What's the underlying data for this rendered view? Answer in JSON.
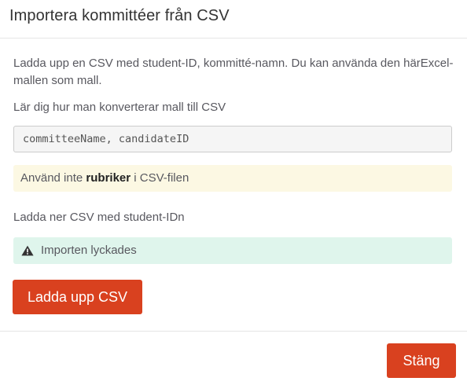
{
  "dialog": {
    "title": "Importera kommittéer från CSV"
  },
  "body": {
    "description": "Ladda upp en CSV med student-ID, kommitté-namn. Du kan använda den härExcel-mallen som mall.",
    "convert_link": "Lär dig hur man konverterar mall till CSV",
    "format_example": "committeeName, candidateID",
    "warning": {
      "before": "Använd inte ",
      "bold": "rubriker",
      "after": " i CSV-filen"
    },
    "download_text": "Ladda ner CSV med student-IDn",
    "success_message": "Importen lyckades",
    "success_icon": "warning-triangle-icon",
    "upload_button": "Ladda upp CSV"
  },
  "footer": {
    "close_button": "Stäng"
  },
  "colors": {
    "primary_button": "#d9411f",
    "warning_bg": "#fcf8e3",
    "success_bg": "#dff5ec"
  }
}
